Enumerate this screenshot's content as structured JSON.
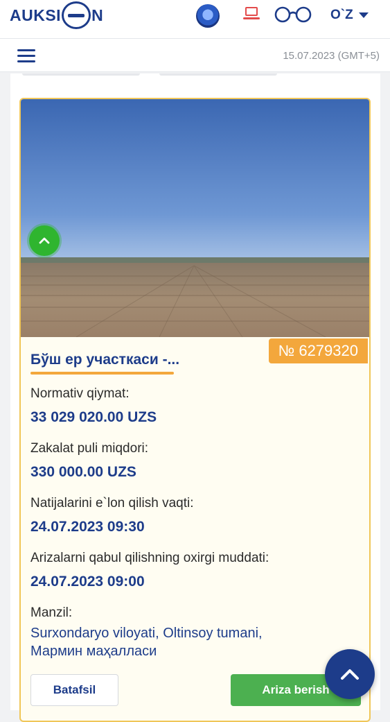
{
  "header": {
    "logo_left": "AUKSI",
    "logo_right": "N",
    "language": "O`Z",
    "icons": [
      "emblem-icon",
      "laptop-icon",
      "glasses-icon",
      "chevron-down-icon"
    ]
  },
  "nav": {
    "datetime": "15.07.2023 (GMT+5)",
    "menu_icon": "hamburger-menu-icon"
  },
  "lot": {
    "number": "№ 6279320",
    "title": "Бўш ер участкаси -...",
    "fields": [
      {
        "label": "Normativ qiymat:",
        "value": "33 029 020.00 UZS"
      },
      {
        "label": "Zakalat puli miqdori:",
        "value": "330 000.00 UZS"
      },
      {
        "label": "Natijalarini e`lon qilish vaqti:",
        "value": "24.07.2023 09:30"
      },
      {
        "label": "Arizalarni qabul qilishning oxirgi muddati:",
        "value": "24.07.2023 09:00"
      }
    ],
    "address_label": "Manzil:",
    "address_line1": "Surxondaryo viloyati, Oltinsoy tumani,",
    "address_line2": "Мармин маҳалласи",
    "details_button": "Batafsil",
    "apply_button": "Ariza berish"
  },
  "colors": {
    "brand": "#1d3c8a",
    "accent": "#f3a73c",
    "apply": "#4cb050"
  }
}
